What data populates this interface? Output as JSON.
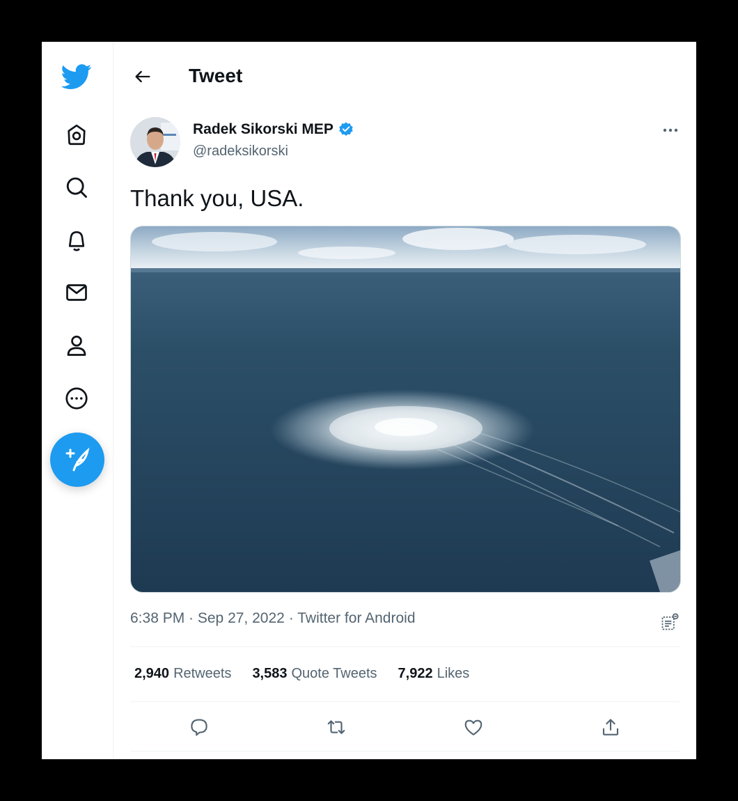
{
  "colors": {
    "accent": "#1d9bf0",
    "text": "#0f1419",
    "secondary": "#536471",
    "border": "#eff3f4"
  },
  "sidebar": {
    "logo_icon": "twitter-bird-icon",
    "items": [
      {
        "name": "home",
        "icon": "home-icon"
      },
      {
        "name": "explore",
        "icon": "search-icon"
      },
      {
        "name": "notifications",
        "icon": "bell-icon"
      },
      {
        "name": "messages",
        "icon": "mail-icon"
      },
      {
        "name": "profile",
        "icon": "person-icon"
      },
      {
        "name": "more",
        "icon": "more-circle-icon"
      }
    ],
    "compose_icon": "compose-feather-icon"
  },
  "header": {
    "title": "Tweet",
    "back_icon": "arrow-left-icon"
  },
  "tweet": {
    "author": {
      "name": "Radek Sikorski MEP",
      "handle": "@radeksikorski",
      "verified": true
    },
    "text": "Thank you, USA.",
    "timestamp": "6:38 PM · Sep 27, 2022",
    "source": "· Twitter for Android",
    "stats": {
      "retweets": {
        "count": "2,940",
        "label": "Retweets"
      },
      "quotes": {
        "count": "3,583",
        "label": "Quote Tweets"
      },
      "likes": {
        "count": "7,922",
        "label": "Likes"
      }
    },
    "actions": [
      "reply-icon",
      "retweet-icon",
      "like-icon",
      "share-icon"
    ]
  }
}
